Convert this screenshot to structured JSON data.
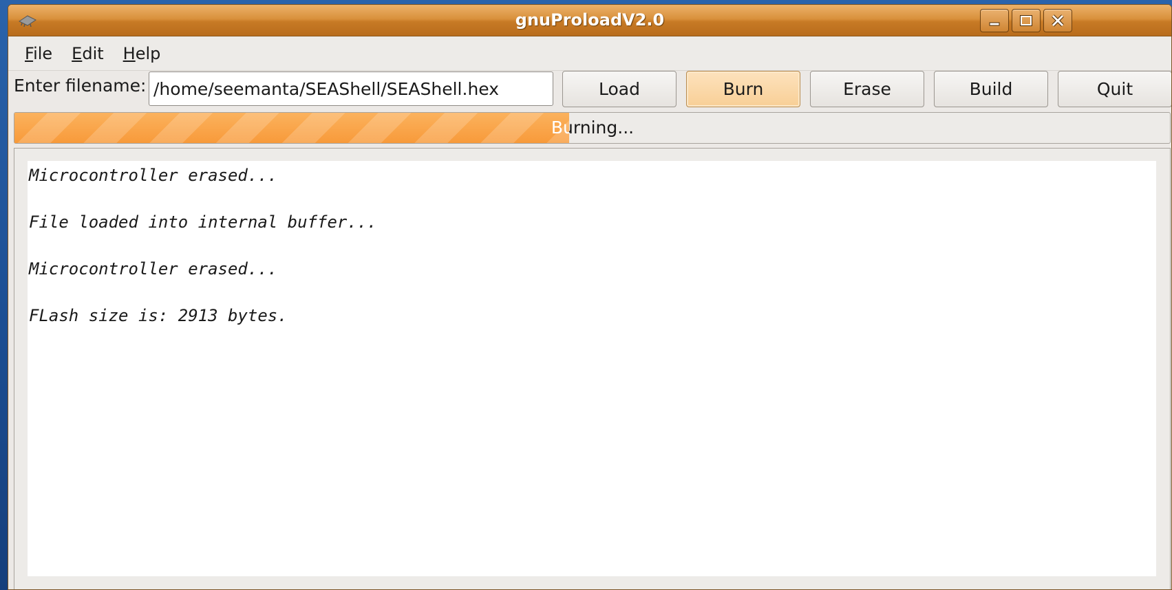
{
  "window": {
    "title": "gnuProloadV2.0",
    "app_icon": "chip-icon",
    "controls": [
      "minimize-icon",
      "maximize-icon",
      "close-icon"
    ]
  },
  "menubar": {
    "items": [
      {
        "mnemonic": "F",
        "rest": "ile"
      },
      {
        "mnemonic": "E",
        "rest": "dit"
      },
      {
        "mnemonic": "H",
        "rest": "elp"
      }
    ]
  },
  "toolbar": {
    "filename_label": "Enter filename:",
    "filename_value": "/home/seemanta/SEAShell/SEAShell.hex",
    "load_label": "Load",
    "burn_label": "Burn",
    "erase_label": "Erase",
    "build_label": "Build",
    "quit_label": "Quit"
  },
  "progress": {
    "text": "Burning...",
    "fraction": 0.48,
    "fill_color": "#f89a3a"
  },
  "log": {
    "lines": [
      "Microcontroller erased...",
      "File loaded into internal buffer...",
      "Microcontroller erased...",
      "FLash size is: 2913 bytes."
    ]
  },
  "colors": {
    "titlebar": "#d9913c",
    "accent_button": "#f8cf96",
    "desktop": "#1c4e93"
  }
}
